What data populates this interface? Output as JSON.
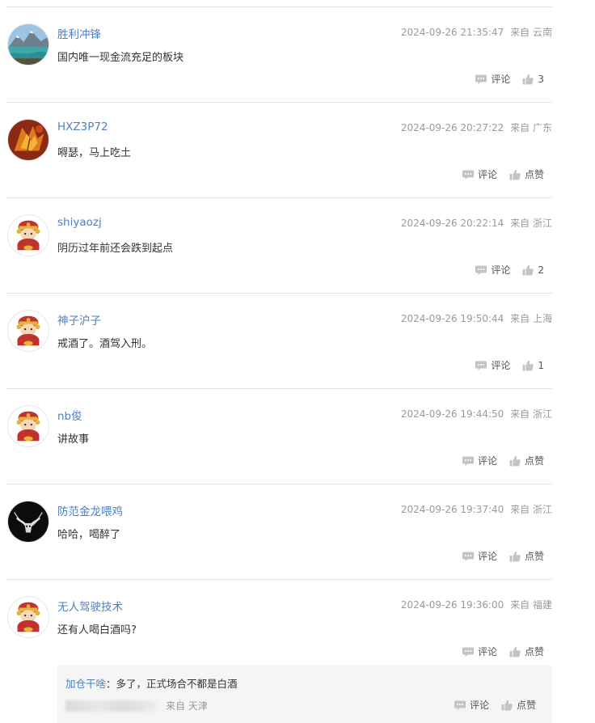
{
  "colors": {
    "username": "#4f7fbf",
    "meta": "#9a9a9a",
    "divider": "#e4e4e4",
    "reply_bg": "#f5f5f5"
  },
  "comments": [
    {
      "user": "胜利冲锋",
      "time": "2024-09-26 21:35:47",
      "from": "来自",
      "location": "云南",
      "text": "国内唯一现金流充足的板块",
      "reply_label": "评论",
      "like_label": "3",
      "avatar": "mountain-lake-photo"
    },
    {
      "user": "HXZ3P72",
      "time": "2024-09-26 20:27:22",
      "from": "来自",
      "location": "广东",
      "text": "嘚瑟，马上吃土",
      "reply_label": "评论",
      "like_label": "点赞",
      "avatar": "autumn-leaf-photo"
    },
    {
      "user": "shiyaozj",
      "time": "2024-09-26 20:22:14",
      "from": "来自",
      "location": "浙江",
      "text": "阴历过年前还会跌到起点",
      "reply_label": "评论",
      "like_label": "2",
      "avatar": "fortune-god-cartoon"
    },
    {
      "user": "神子沪子",
      "time": "2024-09-26 19:50:44",
      "from": "来自",
      "location": "上海",
      "text": "戒酒了。酒驾入刑。",
      "reply_label": "评论",
      "like_label": "1",
      "avatar": "fortune-god-cartoon"
    },
    {
      "user": "nb俊",
      "time": "2024-09-26 19:44:50",
      "from": "来自",
      "location": "浙江",
      "text": "讲故事",
      "reply_label": "评论",
      "like_label": "点赞",
      "avatar": "fortune-god-cartoon"
    },
    {
      "user": "防范金龙喂鸡",
      "time": "2024-09-26 19:37:40",
      "from": "来自",
      "location": "浙江",
      "text": "哈哈，喝醉了",
      "reply_label": "评论",
      "like_label": "点赞",
      "avatar": "bull-skull-necklace-photo"
    },
    {
      "user": "无人驾驶技术",
      "time": "2024-09-26 19:36:00",
      "from": "来自",
      "location": "福建",
      "text": "还有人喝白酒吗?",
      "reply_label": "评论",
      "like_label": "点赞",
      "avatar": "fortune-god-cartoon"
    }
  ],
  "reply": {
    "user": "加仓干啥",
    "separator": "：",
    "text": "多了，正式场合不都是白酒",
    "from": "来自",
    "location": "天津",
    "reply_label": "评论",
    "like_label": "点赞"
  }
}
